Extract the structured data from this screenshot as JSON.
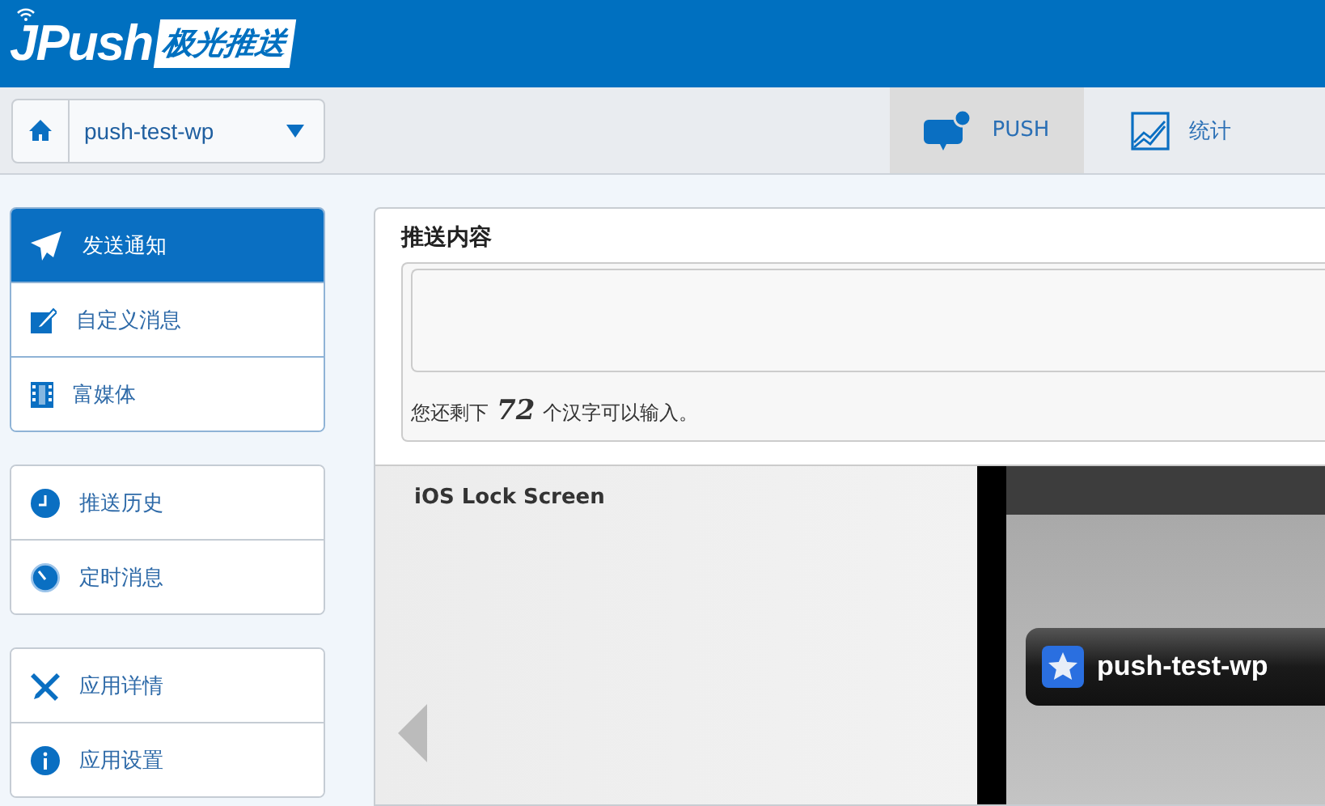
{
  "header": {
    "logo_text": "JPush",
    "logo_subtitle": "极光推送"
  },
  "app_selector": {
    "value": "push-test-wp"
  },
  "tabs": [
    {
      "label": "PUSH",
      "selected": true,
      "kind": "push"
    },
    {
      "label": "统计",
      "selected": false,
      "kind": "stats"
    }
  ],
  "sidebar": {
    "groups": [
      {
        "items": [
          {
            "label": "发送通知",
            "selected": true,
            "kind": "send"
          },
          {
            "label": "自定义消息",
            "selected": false,
            "kind": "edit"
          },
          {
            "label": "富媒体",
            "selected": false,
            "kind": "film"
          }
        ]
      },
      {
        "items": [
          {
            "label": "推送历史",
            "selected": false,
            "kind": "clock"
          },
          {
            "label": "定时消息",
            "selected": false,
            "kind": "timer"
          }
        ]
      },
      {
        "items": [
          {
            "label": "应用详情",
            "selected": false,
            "kind": "tools"
          },
          {
            "label": "应用设置",
            "selected": false,
            "kind": "info"
          }
        ]
      }
    ]
  },
  "push_content": {
    "title": "推送内容",
    "counter_prefix": "您还剩下",
    "counter_value": "72",
    "counter_suffix": "个汉字可以输入。"
  },
  "preview": {
    "title": "iOS Lock Screen",
    "notification_app": "push-test-wp"
  }
}
